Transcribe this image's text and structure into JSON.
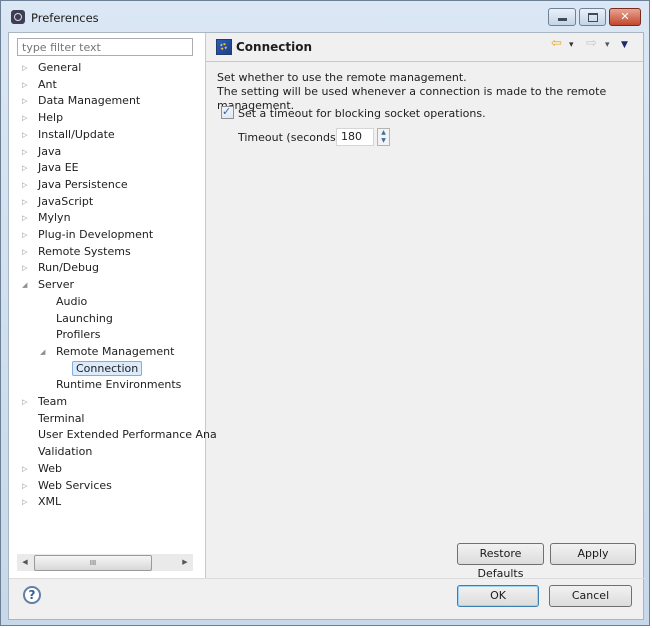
{
  "window": {
    "title": "Preferences"
  },
  "filter": {
    "placeholder": "type filter text",
    "value": ""
  },
  "tree": [
    {
      "label": "General",
      "twisty": "collapsed",
      "level": 0
    },
    {
      "label": "Ant",
      "twisty": "collapsed",
      "level": 0
    },
    {
      "label": "Data Management",
      "twisty": "collapsed",
      "level": 0
    },
    {
      "label": "Help",
      "twisty": "collapsed",
      "level": 0
    },
    {
      "label": "Install/Update",
      "twisty": "collapsed",
      "level": 0
    },
    {
      "label": "Java",
      "twisty": "collapsed",
      "level": 0
    },
    {
      "label": "Java EE",
      "twisty": "collapsed",
      "level": 0
    },
    {
      "label": "Java Persistence",
      "twisty": "collapsed",
      "level": 0
    },
    {
      "label": "JavaScript",
      "twisty": "collapsed",
      "level": 0
    },
    {
      "label": "Mylyn",
      "twisty": "collapsed",
      "level": 0
    },
    {
      "label": "Plug-in Development",
      "twisty": "collapsed",
      "level": 0
    },
    {
      "label": "Remote Systems",
      "twisty": "collapsed",
      "level": 0
    },
    {
      "label": "Run/Debug",
      "twisty": "collapsed",
      "level": 0
    },
    {
      "label": "Server",
      "twisty": "expanded",
      "level": 0
    },
    {
      "label": "Audio",
      "twisty": "none",
      "level": 1
    },
    {
      "label": "Launching",
      "twisty": "none",
      "level": 1
    },
    {
      "label": "Profilers",
      "twisty": "none",
      "level": 1
    },
    {
      "label": "Remote Management",
      "twisty": "expanded",
      "level": 1
    },
    {
      "label": "Connection",
      "twisty": "none",
      "level": 2,
      "selected": true
    },
    {
      "label": "Runtime Environments",
      "twisty": "none",
      "level": 1
    },
    {
      "label": "Team",
      "twisty": "collapsed",
      "level": 0
    },
    {
      "label": "Terminal",
      "twisty": "none",
      "level": 0
    },
    {
      "label": "User Extended Performance Ana",
      "twisty": "none",
      "level": 0
    },
    {
      "label": "Validation",
      "twisty": "none",
      "level": 0
    },
    {
      "label": "Web",
      "twisty": "collapsed",
      "level": 0
    },
    {
      "label": "Web Services",
      "twisty": "collapsed",
      "level": 0
    },
    {
      "label": "XML",
      "twisty": "collapsed",
      "level": 0
    }
  ],
  "scrollbar": {
    "thumb_grip": "III",
    "left_arrow": "◀",
    "right_arrow": "▶"
  },
  "page": {
    "title": "Connection",
    "description_line1": "Set whether to use the remote management.",
    "description_line2": "The setting will be used whenever a connection is made to the remote management.",
    "checkbox_label": "Set a timeout for blocking socket operations.",
    "checkbox_checked": true,
    "timeout_label": "Timeout (seconds):",
    "timeout_value": "180"
  },
  "nav": {
    "back": "⇦",
    "dropdown": "▾",
    "forward": "⇨",
    "menu": "▼"
  },
  "buttons": {
    "restore_defaults": "Restore Defaults",
    "apply": "Apply",
    "ok": "OK",
    "cancel": "Cancel",
    "help": "?"
  },
  "colors": {
    "accent": "#3c7fb1",
    "selection": "#dcebfc",
    "close": "#c3472d"
  }
}
